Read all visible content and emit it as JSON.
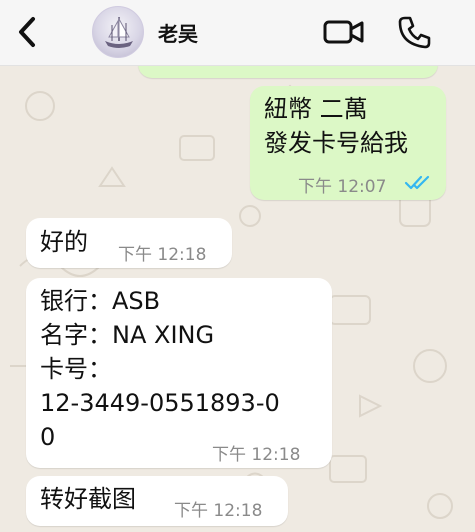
{
  "header": {
    "contact_name": "老吴"
  },
  "colors": {
    "outgoing_bubble": "#dcf8c6",
    "incoming_bubble": "#ffffff",
    "read_ticks": "#34b7f1",
    "wallpaper": "#efeae2"
  },
  "icons": [
    "chevron-left-icon",
    "video-camera-icon",
    "phone-icon",
    "double-check-icon"
  ],
  "messages": [
    {
      "direction": "out",
      "text": "紐幣 二萬\n發发卡号給我",
      "time": "下午 12:07",
      "status": "read"
    },
    {
      "direction": "in",
      "text": "好的",
      "time": "下午 12:18"
    },
    {
      "direction": "in",
      "text": "银行：ASB\n名字：NA XING\n卡号：\n12-3449-0551893-0\n0",
      "time": "下午 12:18"
    },
    {
      "direction": "in",
      "text": "转好截图",
      "time": "下午 12:18"
    }
  ]
}
